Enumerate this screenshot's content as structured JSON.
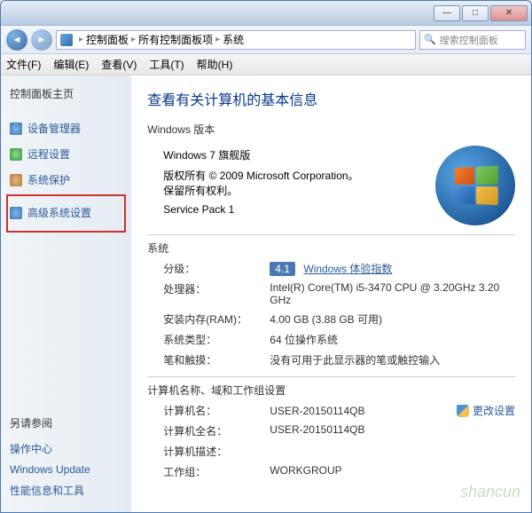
{
  "titlebar": {
    "minimize": "—",
    "maximize": "□",
    "close": "✕"
  },
  "nav": {
    "back": "◄",
    "forward": "►",
    "up": "▲",
    "crumb1": "控制面板",
    "crumb2": "所有控制面板项",
    "crumb3": "系统",
    "refresh": "↻",
    "search_placeholder": "搜索控制面板"
  },
  "menu": {
    "file": "文件(F)",
    "edit": "编辑(E)",
    "view": "查看(V)",
    "tools": "工具(T)",
    "help": "帮助(H)"
  },
  "sidebar": {
    "home": "控制面板主页",
    "device_manager": "设备管理器",
    "remote_settings": "远程设置",
    "system_protection": "系统保护",
    "advanced_settings": "高级系统设置",
    "see_also": "另请参阅",
    "action_center": "操作中心",
    "windows_update": "Windows Update",
    "perf_info": "性能信息和工具"
  },
  "content": {
    "heading": "查看有关计算机的基本信息",
    "edition_title": "Windows 版本",
    "edition_name": "Windows 7 旗舰版",
    "copyright": "版权所有 © 2009 Microsoft Corporation。保留所有权利。",
    "service_pack": "Service Pack 1",
    "system_title": "系统",
    "rating_label": "分级：",
    "rating_value": "4.1",
    "rating_link": "Windows 体验指数",
    "processor_label": "处理器：",
    "processor_value": "Intel(R) Core(TM) i5-3470 CPU @ 3.20GHz 3.20 GHz",
    "ram_label": "安装内存(RAM)：",
    "ram_value": "4.00 GB (3.88 GB 可用)",
    "systype_label": "系统类型：",
    "systype_value": "64 位操作系统",
    "pen_label": "笔和触摸：",
    "pen_value": "没有可用于此显示器的笔或触控输入",
    "domain_title": "计算机名称、域和工作组设置",
    "computer_name_label": "计算机名：",
    "computer_name_value": "USER-20150114QB",
    "change_settings": "更改设置",
    "full_name_label": "计算机全名：",
    "full_name_value": "USER-20150114QB",
    "description_label": "计算机描述：",
    "description_value": "",
    "workgroup_label": "工作组：",
    "workgroup_value": "WORKGROUP"
  },
  "watermark": "shancun"
}
